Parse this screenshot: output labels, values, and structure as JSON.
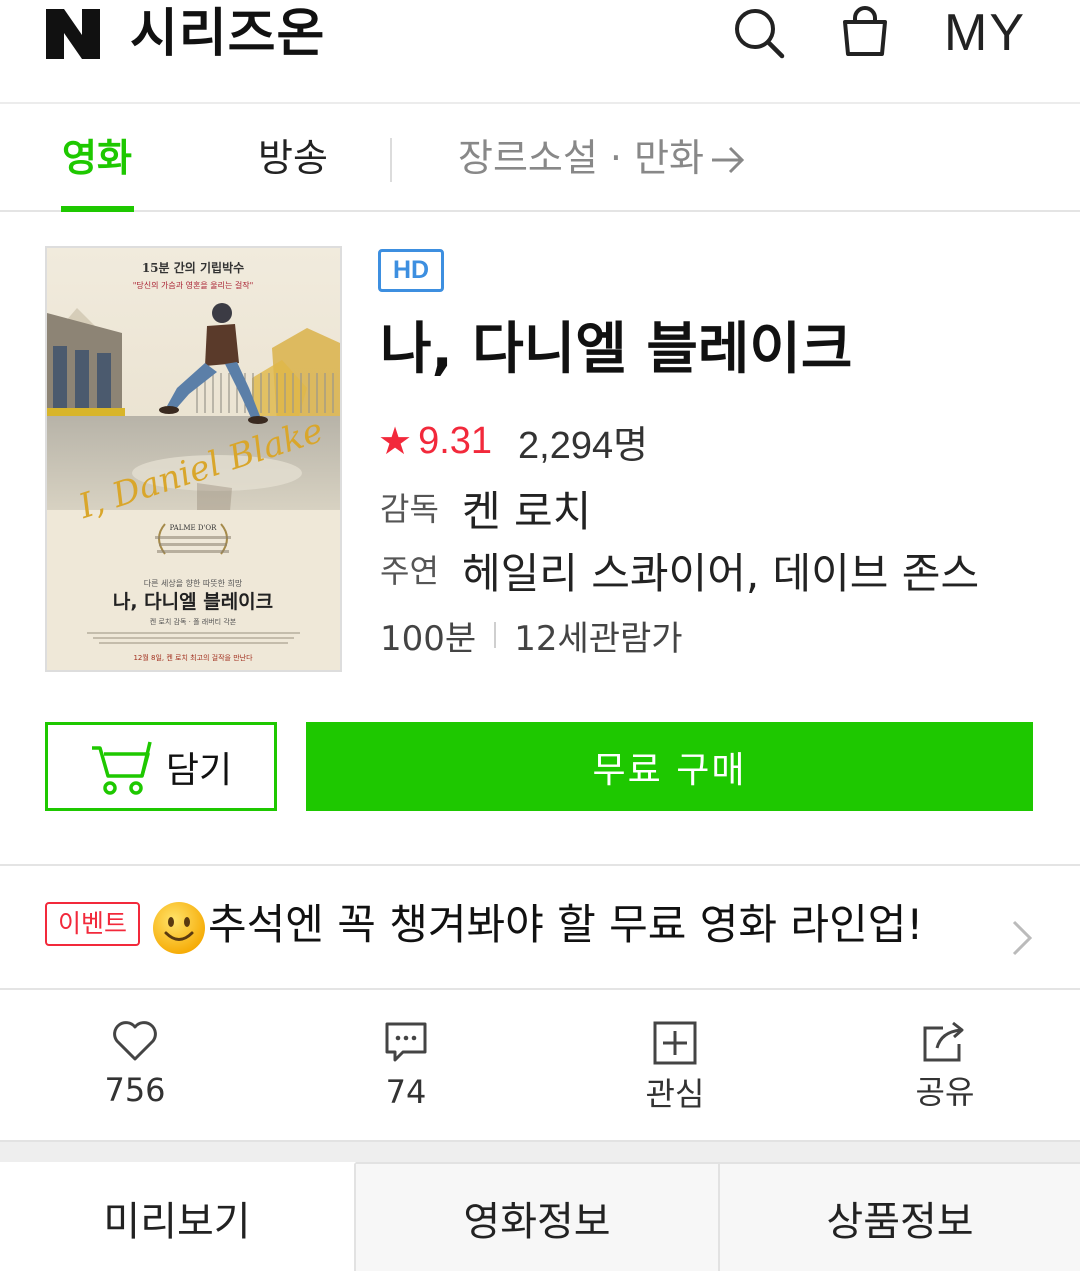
{
  "header": {
    "logo": "N",
    "title": "시리즈온",
    "search_icon": "search-icon",
    "cart_icon": "shopping-bag-icon",
    "my_label": "MY"
  },
  "tabs": {
    "movie": "영화",
    "broadcast": "방송",
    "genre": "장르소설 · 만화",
    "active": "영화"
  },
  "product": {
    "quality_badge": "HD",
    "title": "나, 다니엘 블레이크",
    "rating_star": "★",
    "rating": "9.31",
    "votes": "2,294명",
    "director_label": "감독",
    "director": "켄 로치",
    "cast_label": "주연",
    "cast": "헤일리 스콰이어, 데이브 존스",
    "runtime": "100분",
    "age_rating": "12세관람가"
  },
  "poster": {
    "top_text": "15분 간의 기립박수",
    "quote": "\"당신의 가슴과 영혼을 울리는 걸작\"",
    "script_title": "I, Daniel Blake",
    "award": "PALME D'OR",
    "tagline": "다른 세상을 향한 따뜻한 희망",
    "korean_title": "나, 다니엘 블레이크",
    "credit_line": "켄 로치 감독 · 폴 래버티 각본",
    "bottom_text": "12월 8일, 켄 로치 최고의 걸작을 만난다"
  },
  "buttons": {
    "cart": "담기",
    "buy": "무료 구매"
  },
  "event": {
    "badge": "이벤트",
    "text": "추석엔 꼭 챙겨봐야 할 무료 영화 라인업!"
  },
  "actions": {
    "likes": "756",
    "comments": "74",
    "interest": "관심",
    "share": "공유"
  },
  "bottom_tabs": {
    "preview": "미리보기",
    "movie_info": "영화정보",
    "product_info": "상품정보"
  },
  "colors": {
    "brand_green": "#1ec800",
    "rating_red": "#f2293b",
    "hd_blue": "#3d8fe0"
  }
}
